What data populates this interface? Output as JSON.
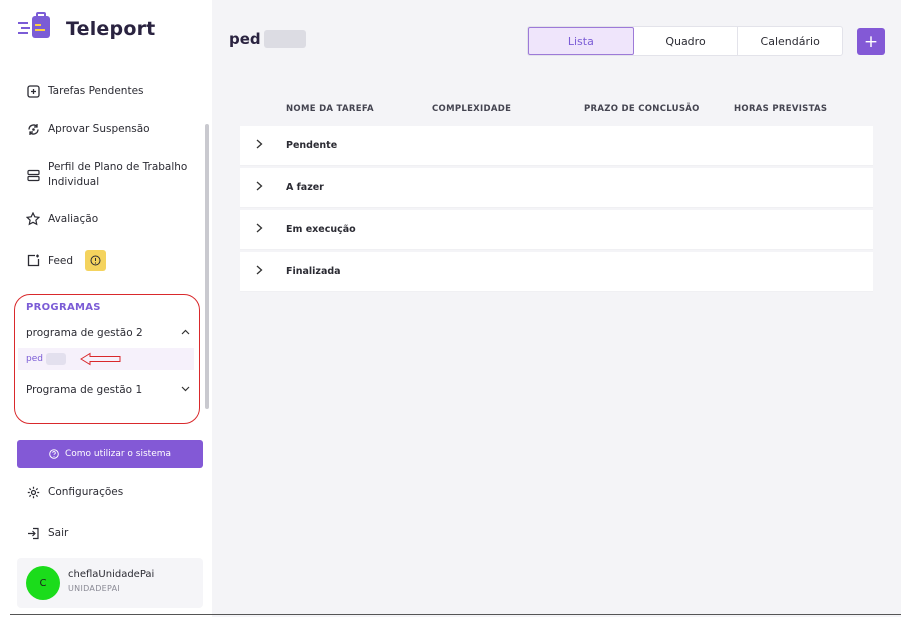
{
  "app": {
    "name": "Teleport"
  },
  "sidebar": {
    "items": [
      {
        "label": "Tarefas Pendentes",
        "icon": "plus-square-icon"
      },
      {
        "label": "Aprovar Suspensão",
        "icon": "refresh-icon"
      },
      {
        "label": "Perfil de Plano de Trabalho Individual",
        "icon": "server-icon"
      },
      {
        "label": "Avaliação",
        "icon": "star-icon"
      },
      {
        "label": "Feed",
        "icon": "feed-icon",
        "badge": "!"
      }
    ],
    "programs": {
      "title": "PROGRAMAS",
      "groups": [
        {
          "label": "programa de gestão 2",
          "expanded": true,
          "children": [
            {
              "label": "ped"
            }
          ]
        },
        {
          "label": "Programa de gestão 1",
          "expanded": false
        }
      ]
    },
    "help_button": "Como utilizar o sistema",
    "settings_label": "Configurações",
    "logout_label": "Sair",
    "user": {
      "initial": "C",
      "name": "cheflaUnidadePai",
      "unit": "UNIDADEPAI"
    }
  },
  "main": {
    "title": "ped",
    "view_tabs": [
      {
        "label": "Lista",
        "active": true
      },
      {
        "label": "Quadro",
        "active": false
      },
      {
        "label": "Calendário",
        "active": false
      }
    ],
    "add_label": "+",
    "columns": [
      "NOME DA TAREFA",
      "COMPLEXIDADE",
      "PRAZO DE CONCLUSÃO",
      "HORAS PREVISTAS"
    ],
    "groups": [
      {
        "label": "Pendente"
      },
      {
        "label": "A fazer"
      },
      {
        "label": "Em execução"
      },
      {
        "label": "Finalizada"
      }
    ]
  },
  "colors": {
    "accent": "#8359d6",
    "badge": "#f4d35e",
    "avatar": "#1bdc1b",
    "annotation": "#d9292c"
  }
}
